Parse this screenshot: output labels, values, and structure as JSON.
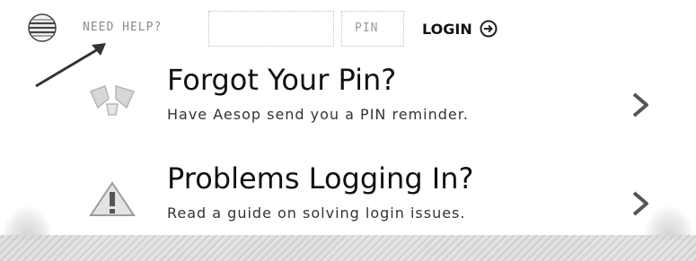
{
  "header": {
    "need_help_label": "NEED HELP?",
    "username_placeholder": "",
    "pin_placeholder": "PIN",
    "login_label": "LOGIN"
  },
  "help_items": [
    {
      "title": "Forgot Your Pin?",
      "description": "Have Aesop send you a PIN reminder.",
      "icon": "broken-lightbulb-icon"
    },
    {
      "title": "Problems Logging In?",
      "description": "Read a guide on solving login issues.",
      "icon": "warning-icon"
    }
  ],
  "colors": {
    "text": "#111111",
    "muted": "#8a8a8a",
    "border": "#bdbdbd"
  }
}
